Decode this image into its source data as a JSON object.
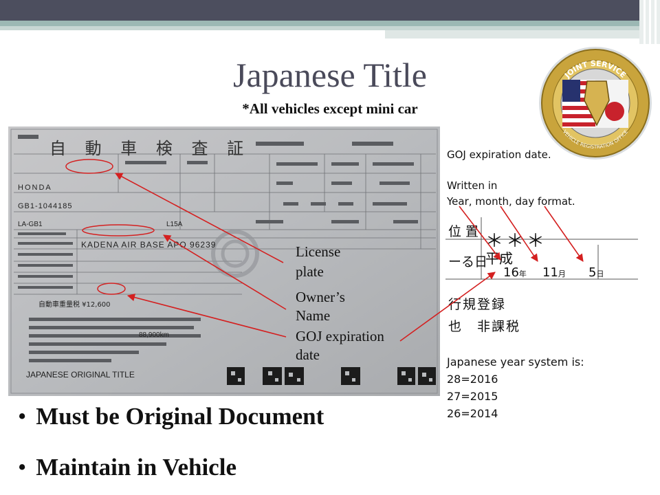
{
  "slide": {
    "title": "Japanese Title",
    "subtitle": "*All vehicles except mini car"
  },
  "seal": {
    "top_text": "JOINT SERVICE",
    "bottom_text": "VEHICLE REGISTRATION OFFICE"
  },
  "document": {
    "heading": "自 動 車 検 査 証",
    "footer_label": "JAPANESE ORIGINAL TITLE",
    "address": "KADENA AIR BASE APO 96239",
    "make": "HONDA",
    "serial": "GB1-1044185",
    "model": "LA-GB1",
    "engine": "L15A",
    "price": "自動車重量税 ¥12,600",
    "mileage": "88,900km"
  },
  "annotations": {
    "license_plate_1": "License",
    "license_plate_2": "plate",
    "owners_name_1": "Owner’s",
    "owners_name_2": "Name",
    "goj_date_1": "GOJ expiration",
    "goj_date_2": "date"
  },
  "right_panel": {
    "goj_expiration": "GOJ expiration date.",
    "written_in": "Written in",
    "format": "Year, month, day format.",
    "year_system_heading": "Japanese year system is:",
    "years": [
      "28=2016",
      "27=2015",
      "26=2014"
    ]
  },
  "crop": {
    "row1_label": "位 置",
    "row2_label": "ーる日",
    "stars": "＊＊＊",
    "era": "平成",
    "year": "16",
    "month": "11",
    "day": "5",
    "year_unit": "年",
    "month_unit": "月",
    "day_unit": "日",
    "row3": "行規登録",
    "row4": "也　非課税"
  },
  "bullets": [
    "Must be Original Document",
    "Maintain in Vehicle"
  ],
  "colors": {
    "top_bar": "#4c4e5e",
    "accent_band": "#9cb8b4",
    "title": "#4a4a5a",
    "annotation_red": "#d42020",
    "seal_gold": "#c9a43c"
  }
}
